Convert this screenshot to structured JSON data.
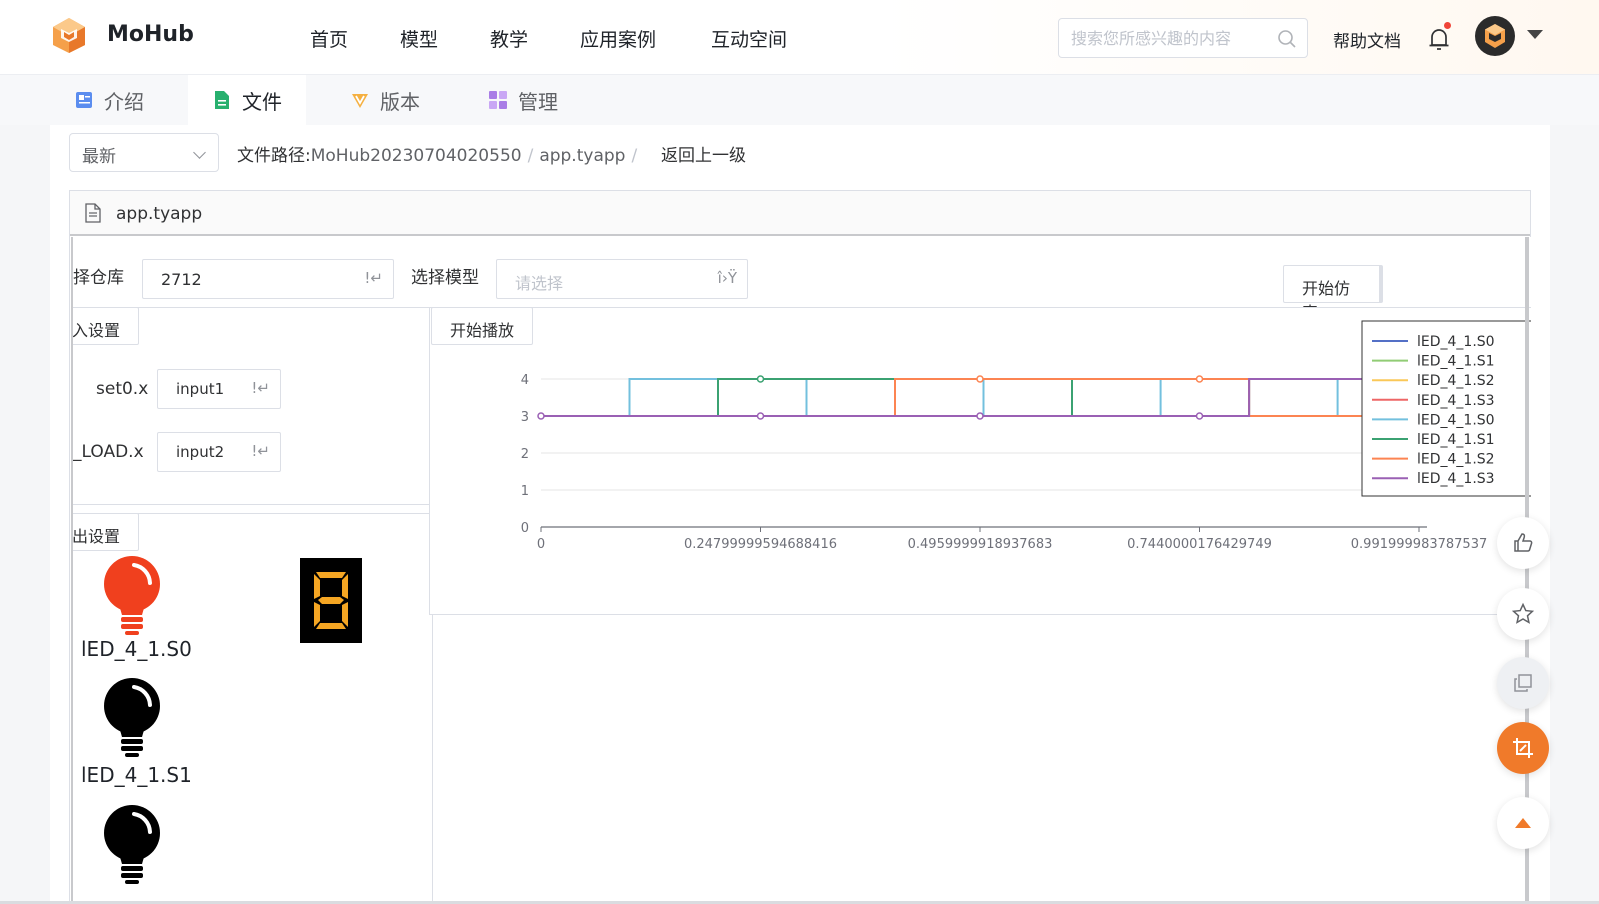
{
  "header": {
    "brand": "MoHub",
    "nav": [
      "首页",
      "模型",
      "教学",
      "应用案例",
      "互动空间"
    ],
    "search_placeholder": "搜索您所感兴趣的内容",
    "help": "帮助文档"
  },
  "tabs": [
    {
      "label": "介绍",
      "icon": "intro-icon"
    },
    {
      "label": "文件",
      "icon": "file-icon",
      "active": true
    },
    {
      "label": "版本",
      "icon": "version-icon"
    },
    {
      "label": "管理",
      "icon": "manage-icon"
    }
  ],
  "toolbar": {
    "version_select": "最新",
    "path_label": "文件路径:",
    "path_root": "MoHub20230704020550",
    "path_file": "app.tyapp",
    "back": "返回上一级"
  },
  "file": {
    "name": "app.tyapp"
  },
  "app": {
    "repo_label": "择仓库",
    "repo_value": "2712",
    "repo_icon": "!↵",
    "model_label": "选择模型",
    "model_placeholder": "请选择",
    "model_icon": "î›Ÿ",
    "start_sim": "开始仿真",
    "input_settings": "入设置",
    "start_play": "开始播放",
    "inputs": [
      {
        "label": "set0.x",
        "value": "input1",
        "icon": "!↵"
      },
      {
        "label": "_LOAD.x",
        "value": "input2",
        "icon": "!↵"
      }
    ],
    "output_settings": "出设置",
    "outputs": [
      {
        "label": "lED_4_1.S0",
        "state": "on",
        "color": "#f0401e"
      },
      {
        "label": "lED_4_1.S1",
        "state": "off",
        "color": "#000000"
      },
      {
        "label": "",
        "state": "off",
        "color": "#000000"
      }
    ],
    "seven_segment": {
      "digit": "8",
      "color": "#f5a623"
    }
  },
  "chart_data": {
    "type": "line",
    "title": "",
    "xlabel": "",
    "ylabel": "",
    "ylim": [
      0,
      4
    ],
    "xlim": [
      0,
      0.9919999837875366
    ],
    "yticks": [
      "0",
      "1",
      "2",
      "3",
      "4"
    ],
    "xticks": [
      "0",
      "0.24799999594688416",
      "0.4959999918937683",
      "0.7440000176429749",
      "0.991999983787537"
    ],
    "xtick_values": [
      0,
      0.24799999594688416,
      0.4959999918937683,
      0.7440000176429749,
      0.9919999837875366
    ],
    "legend_position": "right",
    "series": [
      {
        "name": "lED_4_1.S0",
        "color": "#5470c6",
        "x": [
          0,
          0.992
        ],
        "y": [
          3,
          3
        ]
      },
      {
        "name": "lED_4_1.S1",
        "color": "#91cc75",
        "x": [
          0,
          0.992
        ],
        "y": [
          3,
          3
        ]
      },
      {
        "name": "lED_4_1.S2",
        "color": "#fac858",
        "x": [
          0,
          0.992
        ],
        "y": [
          3,
          3
        ]
      },
      {
        "name": "lED_4_1.S3",
        "color": "#ee6666",
        "x": [
          0,
          0.992
        ],
        "y": [
          3,
          3
        ]
      },
      {
        "name": "lED_4_1.S0",
        "color": "#73c0de",
        "x": [
          0,
          0.1,
          0.1,
          0.3,
          0.3,
          0.5,
          0.5,
          0.7,
          0.7,
          0.9,
          0.9,
          0.992
        ],
        "y": [
          3,
          3,
          4,
          4,
          3,
          3,
          4,
          4,
          3,
          3,
          4,
          4
        ]
      },
      {
        "name": "lED_4_1.S1",
        "color": "#3ba272",
        "x": [
          0,
          0.2,
          0.2,
          0.4,
          0.4,
          0.6,
          0.6,
          0.8,
          0.8,
          0.992
        ],
        "y": [
          3,
          3,
          4,
          4,
          3,
          3,
          4,
          4,
          3,
          3
        ]
      },
      {
        "name": "lED_4_1.S2",
        "color": "#fc8452",
        "x": [
          0,
          0.4,
          0.4,
          0.8,
          0.8,
          0.992
        ],
        "y": [
          3,
          3,
          4,
          4,
          3,
          3
        ]
      },
      {
        "name": "lED_4_1.S3",
        "color": "#9a60b4",
        "x": [
          0,
          0.8,
          0.8,
          0.992
        ],
        "y": [
          3,
          3,
          4,
          4
        ]
      }
    ],
    "markers": [
      {
        "color": "#9a60b4",
        "x": 0,
        "y": 3
      },
      {
        "color": "#3ba272",
        "x": 0.248,
        "y": 4
      },
      {
        "color": "#9a60b4",
        "x": 0.248,
        "y": 3
      },
      {
        "color": "#fc8452",
        "x": 0.496,
        "y": 4
      },
      {
        "color": "#9a60b4",
        "x": 0.496,
        "y": 3
      },
      {
        "color": "#fc8452",
        "x": 0.744,
        "y": 4
      },
      {
        "color": "#9a60b4",
        "x": 0.744,
        "y": 3
      }
    ]
  }
}
